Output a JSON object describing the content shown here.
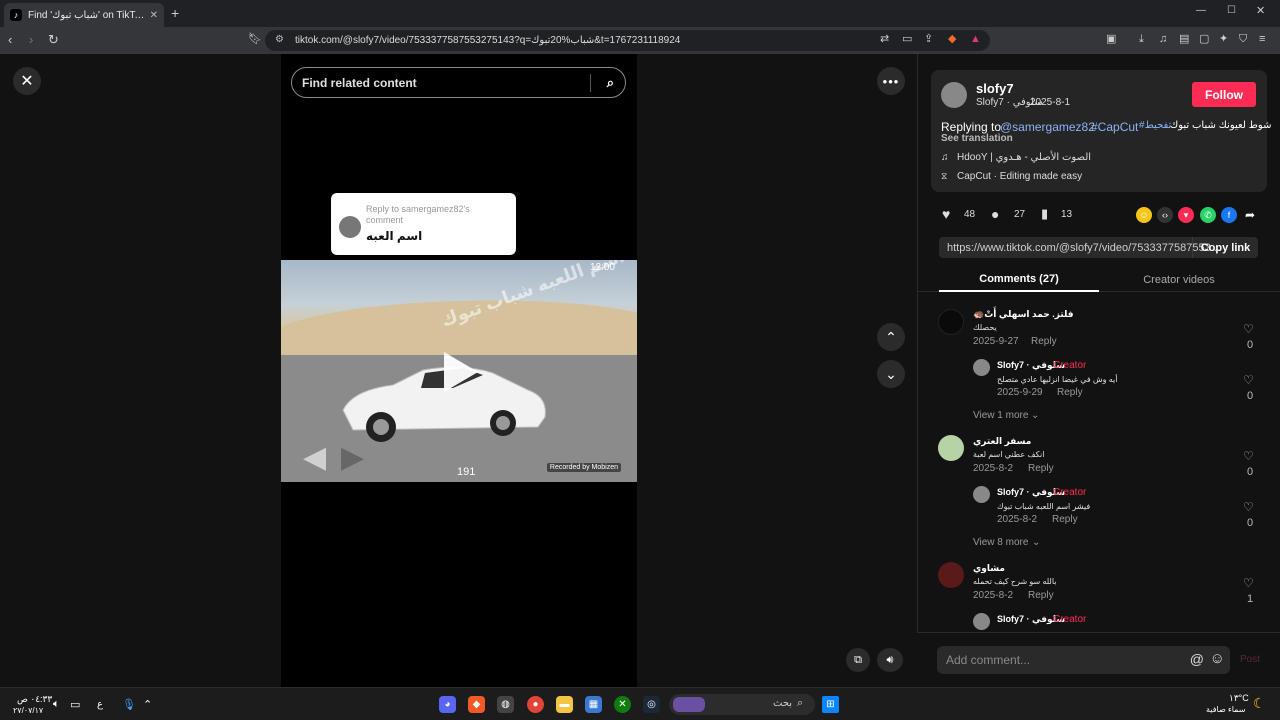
{
  "browser": {
    "tab_title": "Find 'شباب تبوك' on TikTok | TikTok",
    "new_tab_label": "+",
    "url": "tiktok.com/@slofy7/video/7533377587553275143?q=شباب%20تبوك&t=1767231118924",
    "window_controls": {
      "minimize": "—",
      "maximize": "☐",
      "close": "✕"
    }
  },
  "video_pane": {
    "search_placeholder": "Find related content",
    "reply_bubble": {
      "reply_to": "Reply to samergamez82's comment",
      "message": "اسم العبه"
    },
    "overlay": {
      "watermark": "اسم اللعبه شباب تبوك",
      "time": "12:00",
      "speed": "191",
      "recorded_by": "Recorded by Mobizen"
    }
  },
  "post": {
    "username": "slofy7",
    "display_name": "Slofy7 · سلوفي",
    "date": "2025-8-1",
    "follow_label": "Follow",
    "description_prefix": "Replying to",
    "mention": "@samergamez82",
    "hashtag1": "#CapCut",
    "hashtag2": "#تفحيط",
    "description_arabic": "شوط لعيونك شباب تبوك",
    "see_translation": "See translation",
    "music": "HdooY | الصوت الأصلي - هـدوي",
    "capcut": "CapCut · Editing made easy",
    "likes": "48",
    "comments": "27",
    "saves": "13",
    "link": "https://www.tiktok.com/@slofy7/video/7533377587553...",
    "copy_link": "Copy link"
  },
  "tabs": {
    "comments": "Comments (27)",
    "creator_videos": "Creator videos"
  },
  "comments": [
    {
      "name": "🦔فلتز. حمد اسهلي أَتْ",
      "text": "يحصلك",
      "date": "2025-9-27",
      "reply": "Reply",
      "likes": "0",
      "reply_item": {
        "name": "Slofy7 · سلوفي",
        "badge": "Creator",
        "text": "أيه وش في غيضا انزليها عادي متصلح",
        "date": "2025-9-29",
        "reply": "Reply",
        "likes": "0"
      },
      "view_more": "View 1 more"
    },
    {
      "name": "مسفر العتري",
      "text": "انكف عطني اسم لعبة",
      "date": "2025-8-2",
      "reply": "Reply",
      "likes": "0",
      "reply_item": {
        "name": "Slofy7 · سلوفي",
        "badge": "Creator",
        "text": "فيشر اسم اللعبه شباب تبوك",
        "date": "2025-8-2",
        "reply": "Reply",
        "likes": "0"
      },
      "view_more": "View 8 more"
    },
    {
      "name": "مشاوي",
      "text": "بالله سو شرح كيف تحمله",
      "date": "2025-8-2",
      "reply": "Reply",
      "likes": "1",
      "reply_item": {
        "name": "Slofy7 · سلوفي",
        "badge": "Creator"
      }
    }
  ],
  "comment_bar": {
    "placeholder": "Add comment...",
    "post": "Post",
    "at": "@",
    "emoji": "☺"
  },
  "taskbar": {
    "time": "٠٤:٣٣ ص",
    "date": "٢٧/٠٧/١٧",
    "lang": "ع",
    "search": "بحث",
    "weather_temp": "١٣°C",
    "weather_desc": "سماء صافية"
  },
  "colors": {
    "accent": "#fe2c55",
    "mention": "#8ab4f8",
    "creator": "#fe2c55"
  }
}
